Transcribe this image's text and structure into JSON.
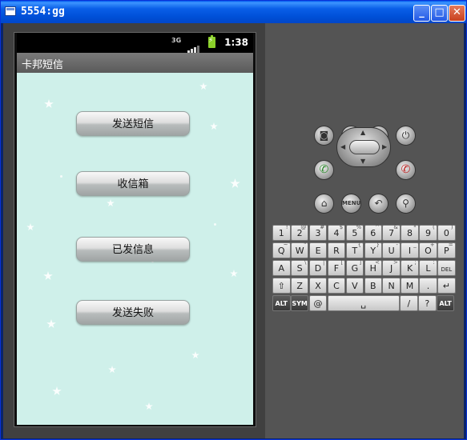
{
  "window": {
    "title": "5554:gg",
    "min_label": "_",
    "max_label": "□",
    "close_label": "✕"
  },
  "phone": {
    "status": {
      "time": "1:38",
      "network": "3G"
    },
    "app_title": "卡邦短信",
    "buttons": [
      "发送短信",
      "收信箱",
      "已发信息",
      "发送失败"
    ]
  },
  "controls": {
    "camera": "camera-icon",
    "vol_down": "volume-down-icon",
    "vol_up": "volume-up-icon",
    "power": "power-icon",
    "call": "call-icon",
    "end": "end-call-icon",
    "home": "home-icon",
    "menu": "MENU",
    "back": "back-icon",
    "search": "search-icon"
  },
  "keyboard": {
    "row1": [
      [
        "1",
        "!"
      ],
      [
        "2",
        "@"
      ],
      [
        "3",
        "#"
      ],
      [
        "4",
        "$"
      ],
      [
        "5",
        "%"
      ],
      [
        "6",
        "^"
      ],
      [
        "7",
        "&"
      ],
      [
        "8",
        "*"
      ],
      [
        "9",
        "("
      ],
      [
        "0",
        ")"
      ]
    ],
    "row2": [
      [
        "Q",
        "~"
      ],
      [
        "W",
        "\""
      ],
      [
        "E",
        "`"
      ],
      [
        "R",
        ""
      ],
      [
        "T",
        "{"
      ],
      [
        "Y",
        "}"
      ],
      [
        "U",
        "-"
      ],
      [
        "I",
        "_"
      ],
      [
        "O",
        "+"
      ],
      [
        "P",
        "="
      ]
    ],
    "row3": [
      [
        "A",
        ""
      ],
      [
        "S",
        "\\"
      ],
      [
        "D",
        "|"
      ],
      [
        "F",
        "["
      ],
      [
        "G",
        "]"
      ],
      [
        "H",
        "<"
      ],
      [
        "J",
        ">"
      ],
      [
        "K",
        ";"
      ],
      [
        "L",
        ":"
      ],
      [
        "DEL",
        ""
      ]
    ],
    "row4": [
      [
        "⇧",
        ""
      ],
      [
        "Z",
        ""
      ],
      [
        "X",
        ""
      ],
      [
        "C",
        ""
      ],
      [
        "V",
        ""
      ],
      [
        "B",
        ""
      ],
      [
        "N",
        ""
      ],
      [
        "M",
        ""
      ],
      [
        ".",
        ""
      ],
      [
        "↵",
        ""
      ]
    ],
    "row5": {
      "alt": "ALT",
      "sym": "SYM",
      "at": "@",
      "space": "␣",
      "slash": "/",
      "q": "?",
      "alt2": "ALT"
    }
  }
}
